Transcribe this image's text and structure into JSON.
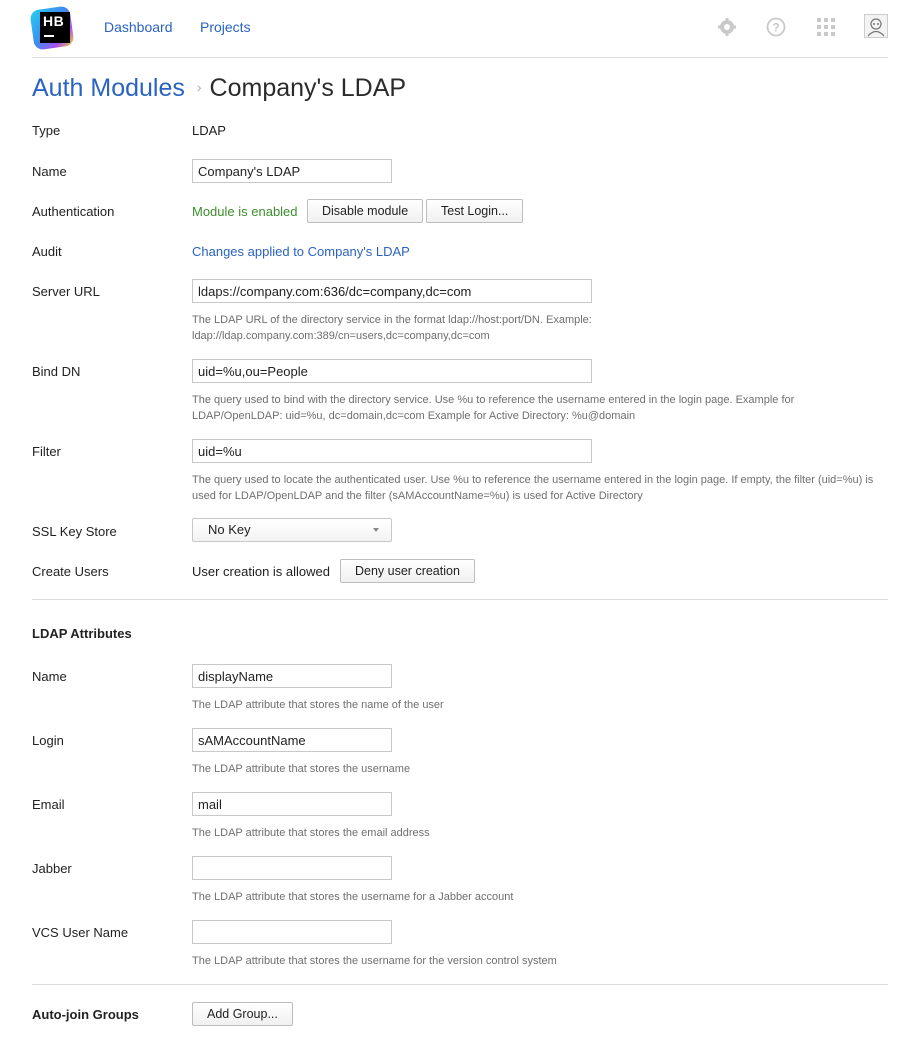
{
  "header": {
    "logo_text": "HB",
    "nav": [
      "Dashboard",
      "Projects"
    ],
    "icons": [
      "settings-icon",
      "help-icon",
      "apps-grid-icon",
      "user-avatar"
    ]
  },
  "breadcrumb": {
    "parent": "Auth Modules",
    "separator": "›",
    "current": "Company's LDAP"
  },
  "form": {
    "type": {
      "label": "Type",
      "value": "LDAP"
    },
    "name": {
      "label": "Name",
      "value": "Company's LDAP"
    },
    "authentication": {
      "label": "Authentication",
      "status": "Module is enabled",
      "disable_btn": "Disable module",
      "test_btn": "Test Login..."
    },
    "audit": {
      "label": "Audit",
      "link": "Changes applied to Company's LDAP"
    },
    "server_url": {
      "label": "Server URL",
      "value": "ldaps://company.com:636/dc=company,dc=com",
      "hint1": "The LDAP URL of the directory service in the format ldap://host:port/DN. Example:",
      "hint2": "ldap://ldap.company.com:389/cn=users,dc=company,dc=com"
    },
    "bind_dn": {
      "label": "Bind DN",
      "value": "uid=%u,ou=People",
      "hint1": "The query used to bind with the directory service. Use %u to reference the username entered in the login page. Example for",
      "hint2": "LDAP/OpenLDAP: uid=%u, dc=domain,dc=com Example for Active Directory: %u@domain"
    },
    "filter": {
      "label": "Filter",
      "value": "uid=%u",
      "hint1": "The query used to locate the authenticated user. Use %u to reference the username entered in the login page. If empty, the filter (uid=%u) is",
      "hint2": "used for LDAP/OpenLDAP and the filter (sAMAccountName=%u) is used for Active Directory"
    },
    "ssl_key_store": {
      "label": "SSL Key Store",
      "value": "No Key"
    },
    "create_users": {
      "label": "Create Users",
      "status": "User creation is allowed",
      "button": "Deny user creation"
    }
  },
  "ldap_attributes": {
    "title": "LDAP Attributes",
    "name": {
      "label": "Name",
      "value": "displayName",
      "hint": "The LDAP attribute that stores the name of the user"
    },
    "login": {
      "label": "Login",
      "value": "sAMAccountName",
      "hint": "The LDAP attribute that stores the username"
    },
    "email": {
      "label": "Email",
      "value": "mail",
      "hint": "The LDAP attribute that stores the email address"
    },
    "jabber": {
      "label": "Jabber",
      "value": "",
      "hint": "The LDAP attribute that stores the username for a Jabber account"
    },
    "vcs": {
      "label": "VCS User Name",
      "value": "",
      "hint": "The LDAP attribute that stores the username for the version control system"
    }
  },
  "auto_join": {
    "label": "Auto-join Groups",
    "button": "Add Group..."
  }
}
